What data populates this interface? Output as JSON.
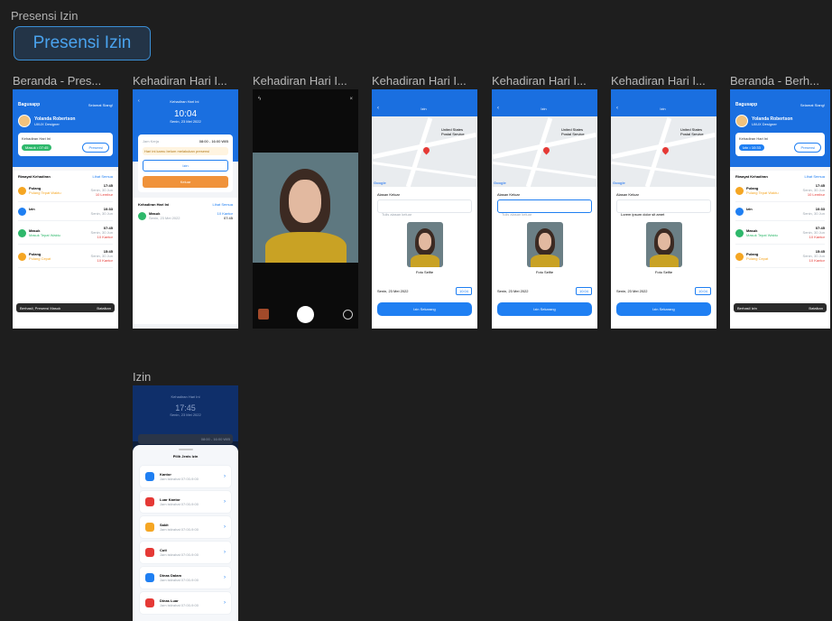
{
  "section": {
    "title": "Presensi Izin",
    "button_label": "Presensi Izin"
  },
  "frames": {
    "f1": {
      "label": "Beranda - Pres...",
      "brand": "Bagusapp",
      "greeting": "Selamat Siang!",
      "name": "Yolanda Robertson",
      "role": "UI/UX Designer",
      "kehadiran_title": "Kehadiran Hari Ini",
      "status": "Masuk • 07:45",
      "presensi_btn": "Presensi",
      "riwayat": "Riwayat Kehadiran",
      "lihat": "Lihat Semua",
      "items": [
        {
          "title": "Pulang",
          "sub": "Pulang Tepat Waktu",
          "time": "17:45",
          "date": "Senin, 30 Jun",
          "extra": "10 Lembur",
          "color": "#f5a623"
        },
        {
          "title": "Izin",
          "sub": "",
          "time": "10:33",
          "date": "Senin, 30 Jun",
          "extra": "",
          "color": "#1f7ff2"
        },
        {
          "title": "Masuk",
          "sub": "Masuk Tepat Waktu",
          "time": "07:45",
          "date": "Senin, 30 Jun",
          "extra": "10 Kantor",
          "color": "#2eb86b"
        },
        {
          "title": "Pulang",
          "sub": "Pulang Cepat",
          "time": "15:45",
          "date": "Senin, 30 Jun",
          "extra": "10 Kantor",
          "color": "#f5a623"
        }
      ],
      "toast": "Berhasil, Presensi Masuk",
      "toast_action": "Batalkan"
    },
    "f2": {
      "label": "Kehadiran Hari I...",
      "title": "Kehadiran Hari Ini",
      "time": "10:04",
      "date": "Senin, 23 Mei 2022",
      "jam_kerja": "Jam Kerja",
      "jam_range": "08:00 - 16:00 WIB",
      "warning": "Hari ini kamu belum melakukan presensi",
      "izin_btn": "Izin",
      "keluar_btn": "Keluar",
      "list_title": "Kehadiran Hari Ini",
      "lihat": "Lihat Semua",
      "row_title": "Masuk",
      "row_date": "Senin, 23 Mei 2022",
      "row_badge": "10 Kantor",
      "row_time": "07:45"
    },
    "f3": {
      "label": "Kehadiran Hari I..."
    },
    "f4": {
      "label": "Kehadiran Hari I...",
      "title": "Izin",
      "map_label": "United States Postal Service",
      "alasan": "Alasan Keluar",
      "placeholder": "Tulis alasan keluar",
      "foto": "Foto Selfie",
      "date": "Senin, 23 Mei 2022",
      "time": "10:04",
      "btn": "Izin Sekarang"
    },
    "f5": {
      "label": "Kehadiran Hari I...",
      "title": "Izin",
      "map_label": "United States Postal Service",
      "alasan": "Alasan Keluar",
      "placeholder": "Tulis alasan keluar",
      "foto": "Foto Selfie",
      "date": "Senin, 23 Mei 2022",
      "time": "10:04",
      "btn": "Izin Sekarang"
    },
    "f6": {
      "label": "Kehadiran Hari I...",
      "title": "Izin",
      "map_label": "United States Postal Service",
      "alasan": "Alasan Keluar",
      "value": "Lorem ipsum dolor sit amet",
      "foto": "Foto Selfie",
      "date": "Senin, 23 Mei 2022",
      "time": "10:04",
      "btn": "Izin Sekarang"
    },
    "f7": {
      "label": "Beranda - Berh...",
      "brand": "Bagusapp",
      "greeting": "Selamat Siang!",
      "name": "Yolanda Robertson",
      "role": "UI/UX Designer",
      "kehadiran_title": "Kehadiran Hari Ini",
      "status": "Izin • 10:33",
      "presensi_btn": "Presensi",
      "riwayat": "Riwayat Kehadiran",
      "lihat": "Lihat Semua",
      "items": [
        {
          "title": "Pulang",
          "sub": "Pulang Tepat Waktu",
          "time": "17:45",
          "date": "Senin, 30 Jun",
          "extra": "10 Lembur",
          "color": "#f5a623"
        },
        {
          "title": "Izin",
          "sub": "",
          "time": "10:33",
          "date": "Senin, 30 Jun",
          "extra": "",
          "color": "#1f7ff2"
        },
        {
          "title": "Masuk",
          "sub": "Masuk Tepat Waktu",
          "time": "07:45",
          "date": "Senin, 30 Jun",
          "extra": "10 Kantor",
          "color": "#2eb86b"
        },
        {
          "title": "Pulang",
          "sub": "Pulang Cepat",
          "time": "15:45",
          "date": "Senin, 30 Jun",
          "extra": "10 Kantor",
          "color": "#f5a623"
        }
      ],
      "toast": "Berhasil Izin",
      "toast_action": "Batalkan"
    },
    "f8": {
      "label": "Izin",
      "title": "Kehadiran Hari Ini",
      "time": "17:45",
      "date": "Senin, 23 Mei 2022",
      "jam_range": "08:00 - 16:00 WIB",
      "sheet_title": "Pilih Jenis Izin",
      "items": [
        {
          "title": "Kantor",
          "sub": "Jam istirahat 07:00-9:00",
          "color": "#1f7ff2"
        },
        {
          "title": "Luar Kantor",
          "sub": "Jam istirahat 07:00-9:00",
          "color": "#e53935"
        },
        {
          "title": "Sakit",
          "sub": "Jam istirahat 07:00-9:00",
          "color": "#f5a623"
        },
        {
          "title": "Cuti",
          "sub": "Jam istirahat 07:00-9:00",
          "color": "#e53935"
        },
        {
          "title": "Dinas Dalam",
          "sub": "Jam istirahat 07:00-9:00",
          "color": "#1f7ff2"
        },
        {
          "title": "Dinas Luar",
          "sub": "Jam istirahat 07:00-9:00",
          "color": "#e53935"
        }
      ]
    }
  }
}
